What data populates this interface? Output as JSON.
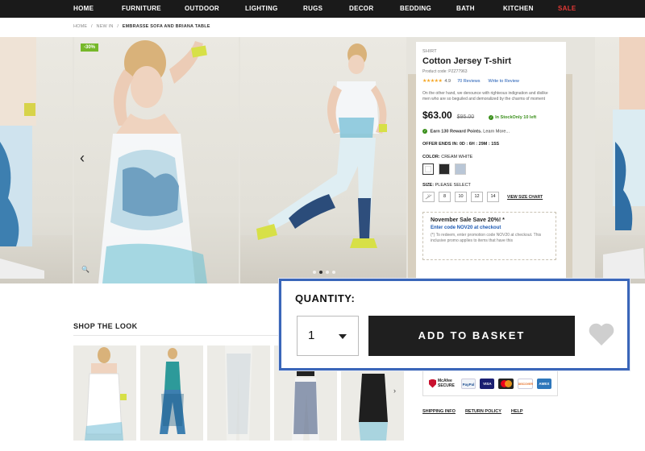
{
  "nav": {
    "items": [
      "HOME",
      "FURNITURE",
      "OUTDOOR",
      "LIGHTING",
      "RUGS",
      "DECOR",
      "BEDDING",
      "BATH",
      "KITCHEN",
      "SALE"
    ]
  },
  "breadcrumb": [
    "HOME",
    "/",
    "NEW IN",
    "/",
    "EMBRASSE SOFA AND BRIANA TABLE"
  ],
  "gallery": {
    "badge": "-30%",
    "prev_icon": "chevron-left-icon",
    "zoom_icon": "magnifier-icon",
    "dot_count": 4,
    "active_dot": 1
  },
  "product": {
    "category": "SHIRT",
    "title": "Cotton Jersey T-shirt",
    "code": "Product code: PZZ77963",
    "rating": "4.9",
    "reviews": "70 Reviews",
    "write_review": "Write to Review",
    "description": "On the other hand, we denounce with righteous indignation and dislike men who are so beguiled and demoralized by the charms of moment",
    "price": "$63.00",
    "old_price": "$95.00",
    "stock": "In Stock",
    "stock_note": "Only 10 left",
    "reward_bold": "Earn 130 Reward Points.",
    "reward_link": "Learn More...",
    "offer": "OFFER ENDS IN: 0D : 6H : 29M : 15S",
    "color_label": "COLOR:",
    "color_value": "CREAM WHITE",
    "swatches": [
      "#ffffff",
      "#2b2b2b",
      "#b9c6d6"
    ],
    "size_label": "SIZE:",
    "size_value": "PLEASE SELECT",
    "sizes": [
      "X",
      "8",
      "10",
      "12",
      "14"
    ],
    "size_chart": "VIEW SIZE CHART",
    "promo": {
      "headline": "November Sale Save 20%! *",
      "code_line": "Enter code NOV20 at checkout",
      "detail": "(*) To redeem, enter promotion code NOV20 at checkout. This inclusive promo applies to items that have this"
    }
  },
  "quantity_popup": {
    "label": "QUANTITY:",
    "selected": "1",
    "add_button": "ADD TO BASKET",
    "wishlist_icon": "heart-icon"
  },
  "shop_the_look": {
    "title": "SHOP THE LOOK",
    "prev_icon": "chevron-left-icon",
    "next_icon": "chevron-right-icon"
  },
  "payment": {
    "mcafee_line1": "McAfee",
    "mcafee_line2": "SECURE",
    "cards": [
      "PayPal",
      "VISA",
      "MC",
      "DISCOVER",
      "AMEX"
    ]
  },
  "footer_links": [
    "SHIPPING INFO",
    "RETURN POLICY",
    "HELP"
  ],
  "colors": {
    "nav_bg": "#1a1a1a",
    "sale": "#e53935",
    "badge": "#76b82a",
    "link": "#1d5ab3",
    "stock": "#3a8f1b",
    "popup_border": "#3a66b9",
    "button": "#1f1f1f"
  }
}
